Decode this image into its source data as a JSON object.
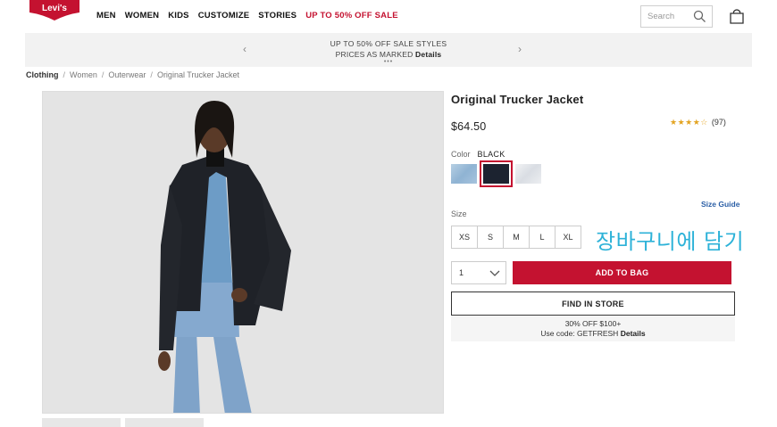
{
  "brand": {
    "logo_text": "Levi's",
    "accent": "#c41230"
  },
  "nav": [
    "MEN",
    "WOMEN",
    "KIDS",
    "CUSTOMIZE",
    "STORIES"
  ],
  "nav_sale": "UP TO 50% OFF SALE",
  "search": {
    "placeholder": "Search"
  },
  "promo": {
    "line1": "UP TO 50% OFF SALE STYLES",
    "line2": "PRICES AS MARKED",
    "link": "Details",
    "prev": "‹",
    "next": "›",
    "dots": "•••"
  },
  "breadcrumb": [
    "Clothing",
    "Women",
    "Outerwear",
    "Original Trucker Jacket"
  ],
  "product": {
    "title": "Original Trucker Jacket",
    "price": "$64.50",
    "stars": "★★★★☆",
    "review_count": "(97)",
    "color_label": "Color",
    "color_value": "BLACK",
    "swatches": [
      {
        "name": "light-blue",
        "color": "#9fbfd9"
      },
      {
        "name": "black",
        "color": "#1c2330",
        "selected": true
      },
      {
        "name": "white",
        "color": "#e6e8ec"
      }
    ],
    "size_guide": "Size Guide",
    "size_label": "Size",
    "sizes": [
      "XS",
      "S",
      "M",
      "L",
      "XL"
    ],
    "qty": "1",
    "add_to_bag": "ADD TO BAG",
    "find_in_store": "FIND IN STORE",
    "offer_line1": "30% OFF $100+",
    "offer_line2": "Use code: GETFRESH",
    "offer_link": "Details"
  },
  "annotation": "장바구니에 담기"
}
